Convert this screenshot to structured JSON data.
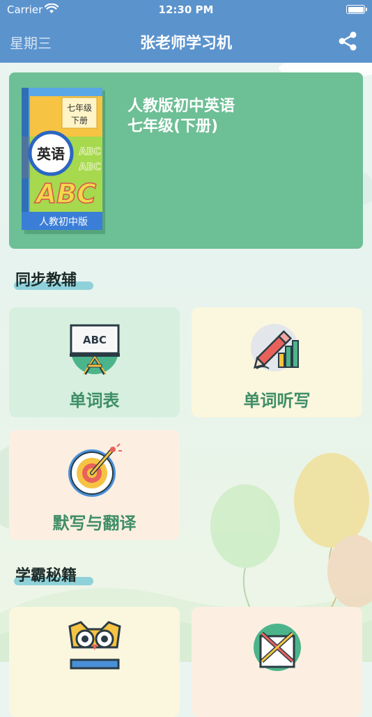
{
  "status_bar": {
    "carrier": "Carrier",
    "time": "12:30 PM"
  },
  "nav": {
    "left_label": "星期三",
    "title": "张老师学习机"
  },
  "book": {
    "title_line1": "人教版初中英语",
    "title_line2": "七年级(下册)",
    "cover": {
      "grade": "七年级",
      "volume": "下册",
      "subject": "英语",
      "letters": "ABC",
      "small_letters": "ABC",
      "edition": "人教初中版"
    }
  },
  "sections": [
    {
      "title": "同步教辅",
      "tiles": [
        {
          "label": "单词表",
          "icon": "abc-easel-icon",
          "board_text": "ABC"
        },
        {
          "label": "单词听写",
          "icon": "pencil-chart-icon"
        },
        {
          "label": "默写与翻译",
          "icon": "target-pencil-icon"
        }
      ]
    },
    {
      "title": "学霸秘籍",
      "tiles": [
        {
          "icon": "owl-book-icon"
        },
        {
          "icon": "crossed-tools-icon"
        }
      ]
    }
  ],
  "colors": {
    "nav_blue": "#5b93cd",
    "card_green": "#6dbf95",
    "label_green": "#3f8e67",
    "tile_green": "#d7efdf",
    "tile_cream": "#fbf6de",
    "tile_peach": "#fcefe2"
  }
}
